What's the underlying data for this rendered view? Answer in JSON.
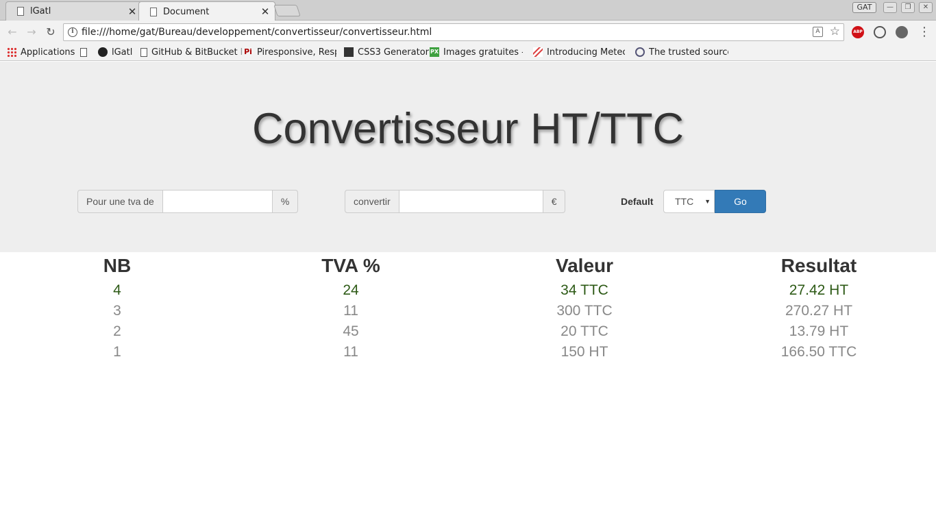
{
  "browser": {
    "tabs": [
      {
        "title": "lGatl",
        "active": false
      },
      {
        "title": "Document",
        "active": true
      }
    ],
    "user_badge": "GAT",
    "url": "file:///home/gat/Bureau/developpement/convertisseur/convertisseur.html",
    "bookmarks": [
      {
        "label": "Applications",
        "icon": "apps-grid-icon"
      },
      {
        "label": "",
        "icon": "page-icon"
      },
      {
        "label": "lGatl",
        "icon": "github-icon"
      },
      {
        "label": "GitHub & BitBucket",
        "suffix": "I",
        "icon": "page-icon"
      },
      {
        "label": "Piresponsive, Respo",
        "icon": "pi-icon"
      },
      {
        "label": "CSS3 Generator",
        "icon": "css3-icon"
      },
      {
        "label": "Images gratuites - P",
        "icon": "px-icon"
      },
      {
        "label": "Introducing Meteor",
        "icon": "meteor-icon"
      },
      {
        "label": "The trusted source f",
        "icon": "globe-icon"
      }
    ]
  },
  "page": {
    "title": "Convertisseur HT/TTC",
    "tva_group": {
      "prefix": "Pour une tva de",
      "value": "",
      "suffix": "%"
    },
    "convert_group": {
      "prefix": "convertir",
      "value": "",
      "suffix": "€"
    },
    "default_label": "Default",
    "default_select": {
      "selected": "TTC"
    },
    "go_label": "Go"
  },
  "results": {
    "headers": [
      "NB",
      "TVA %",
      "Valeur",
      "Resultat"
    ],
    "rows": [
      {
        "nb": "4",
        "tva": "24",
        "valeur": "34 TTC",
        "resultat": "27.42 HT",
        "latest": true
      },
      {
        "nb": "3",
        "tva": "11",
        "valeur": "300 TTC",
        "resultat": "270.27 HT",
        "latest": false
      },
      {
        "nb": "2",
        "tva": "45",
        "valeur": "20 TTC",
        "resultat": "13.79 HT",
        "latest": false
      },
      {
        "nb": "1",
        "tva": "11",
        "valeur": "150 HT",
        "resultat": "166.50 TTC",
        "latest": false
      }
    ]
  }
}
